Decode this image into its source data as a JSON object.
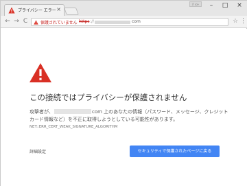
{
  "tab": {
    "title": "プライバシー エラー",
    "close": "×"
  },
  "window": {
    "profile": "ｸﾞﾗﾝﾄ",
    "minimize": "–",
    "maximize": "□",
    "close": "×"
  },
  "toolbar": {
    "back": "←",
    "forward": "→",
    "reload": "C",
    "security_label": "保護されていません",
    "url_scheme": "https",
    "url_slashes": "://",
    "url_tld": "com",
    "star": "☆",
    "menu": "⋮"
  },
  "page": {
    "heading": "この接続ではプライバシーが保護されません",
    "desc_prefix": "攻撃者が、",
    "desc_domain_tld": "com",
    "desc_suffix": " 上のあなたの情報（パスワード、メッセージ、クレジット",
    "desc_line2": "カード情報など）を不正に取得しようとしている可能性があります。",
    "error_code": "NET::ERR_CERT_WEAK_SIGNATURE_ALGORITHM",
    "details_label": "詳細設定",
    "back_button_label": "セキュリティで保護されたページに戻る"
  },
  "colors": {
    "warning_red": "#d93025",
    "button_blue": "#4285f4",
    "insecure_text": "#c5221f"
  },
  "icons": {
    "favicon": "warning-triangle-icon",
    "omnibox": "warning-triangle-icon",
    "main": "warning-triangle-icon"
  }
}
